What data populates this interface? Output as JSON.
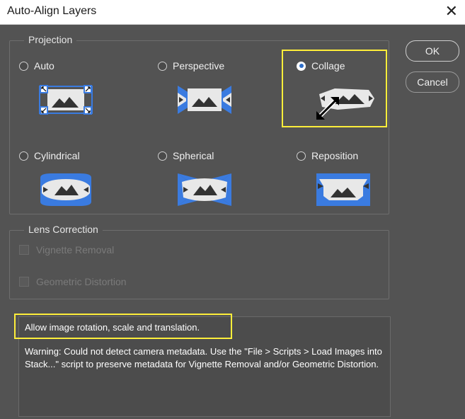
{
  "window": {
    "title": "Auto-Align Layers",
    "close_icon": "close-icon"
  },
  "projection": {
    "label": "Projection",
    "options": [
      {
        "label": "Auto",
        "selected": false,
        "icon": "auto-projection-icon"
      },
      {
        "label": "Perspective",
        "selected": false,
        "icon": "perspective-projection-icon"
      },
      {
        "label": "Collage",
        "selected": true,
        "icon": "collage-projection-icon"
      },
      {
        "label": "Cylindrical",
        "selected": false,
        "icon": "cylindrical-projection-icon"
      },
      {
        "label": "Spherical",
        "selected": false,
        "icon": "spherical-projection-icon"
      },
      {
        "label": "Reposition",
        "selected": false,
        "icon": "reposition-projection-icon"
      }
    ]
  },
  "lens": {
    "label": "Lens Correction",
    "vignette": {
      "label": "Vignette Removal",
      "checked": false,
      "enabled": false
    },
    "geometric": {
      "label": "Geometric Distortion",
      "checked": false,
      "enabled": false
    }
  },
  "buttons": {
    "ok": "OK",
    "cancel": "Cancel"
  },
  "info": {
    "description": "Allow image rotation, scale and translation.",
    "warning": "Warning: Could not detect camera metadata. Use the \"File > Scripts > Load Images into Stack...\" script to preserve metadata for Vignette Removal and/or Geometric Distortion."
  },
  "colors": {
    "accent": "#3a7be0",
    "highlight": "#ffee3a",
    "thumb": "#e8e8e8",
    "mountain": "#333333"
  }
}
